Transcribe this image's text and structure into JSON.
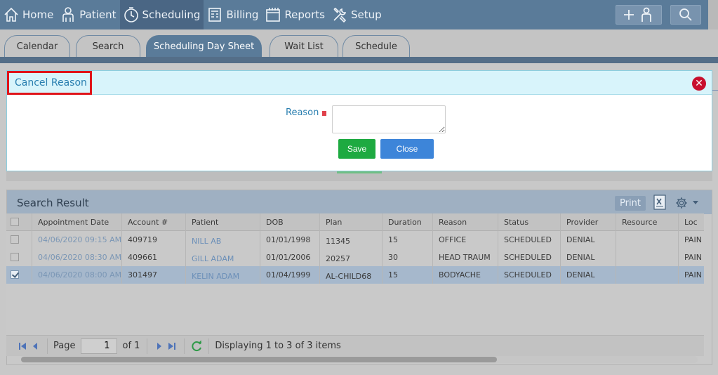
{
  "nav": {
    "items": [
      {
        "label": "Home",
        "icon": "home-icon"
      },
      {
        "label": "Patient",
        "icon": "patient-icon"
      },
      {
        "label": "Scheduling",
        "icon": "clock-icon",
        "active": true
      },
      {
        "label": "Billing",
        "icon": "billing-icon"
      },
      {
        "label": "Reports",
        "icon": "calendar-icon"
      },
      {
        "label": "Setup",
        "icon": "tools-icon"
      }
    ],
    "add_patient_icon": "add-patient-icon",
    "search_icon": "search-icon"
  },
  "tabs": [
    {
      "label": "Calendar"
    },
    {
      "label": "Search"
    },
    {
      "label": "Scheduling Day Sheet",
      "active": true
    },
    {
      "label": "Wait List"
    },
    {
      "label": "Schedule"
    }
  ],
  "dialog": {
    "title": "Cancel Reason",
    "reason_label": "Reason",
    "reason_value": "",
    "save_label": "Save",
    "close_label": "Close"
  },
  "results": {
    "title": "Search Result",
    "print_label": "Print",
    "columns": [
      "Appointment Date",
      "Account #",
      "Patient",
      "DOB",
      "Plan",
      "Duration",
      "Reason",
      "Status",
      "Provider",
      "Resource",
      "Loc"
    ],
    "rows": [
      {
        "checked": false,
        "date": "04/06/2020 09:15 AM",
        "account": "409719",
        "patient": "NILL AB",
        "dob": "01/01/1998",
        "plan": "11345",
        "duration": "15",
        "reason": "OFFICE",
        "status": "SCHEDULED",
        "provider": "DENIAL",
        "resource": "",
        "loc": "PAIN"
      },
      {
        "checked": false,
        "date": "04/06/2020 08:30 AM",
        "account": "409661",
        "patient": "GILL ADAM",
        "dob": "01/01/2006",
        "plan": "20257",
        "duration": "30",
        "reason": "HEAD TRAUM",
        "status": "SCHEDULED",
        "provider": "DENIAL",
        "resource": "",
        "loc": "PAIN"
      },
      {
        "checked": true,
        "date": "04/06/2020 08:00 AM",
        "account": "301497",
        "patient": "KELIN ADAM",
        "dob": "01/04/1999",
        "plan": "AL-CHILD68",
        "duration": "15",
        "reason": "BODYACHE",
        "status": "SCHEDULED",
        "provider": "DENIAL",
        "resource": "",
        "loc": "PAIN"
      }
    ]
  },
  "pager": {
    "page_label": "Page",
    "page_value": "1",
    "of_label": "of 1",
    "display_text": "Displaying 1 to 3 of 3 items"
  },
  "colors": {
    "nav_bg": "#5a7b99",
    "dialog_header_bg": "#d8f4fb",
    "title_highlight": "#e0141a",
    "save_green": "#1eaa41",
    "close_blue": "#3d85d9"
  }
}
